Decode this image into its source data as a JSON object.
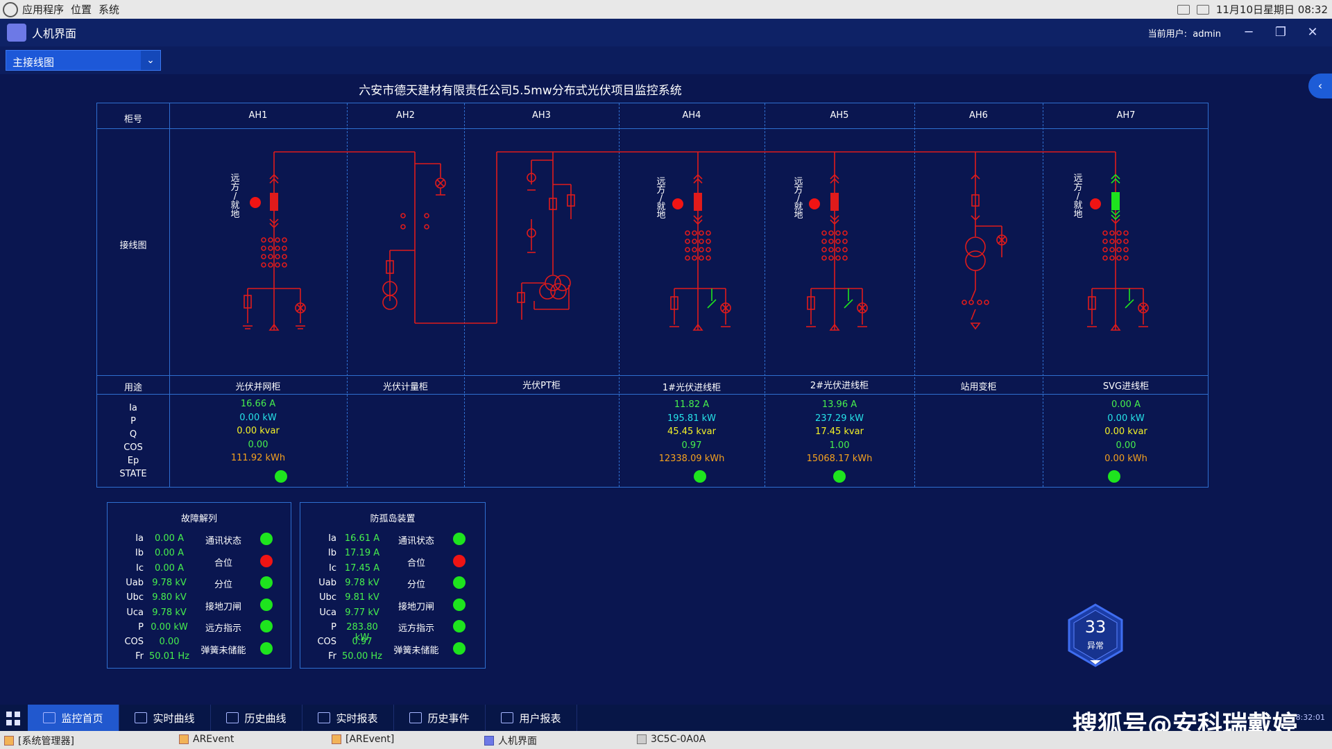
{
  "os_topbar": {
    "menu": [
      "应用程序",
      "位置",
      "系统"
    ],
    "datetime": "11月10日星期日 08:32"
  },
  "window": {
    "title": "人机界面",
    "user_label": "当前用户:",
    "user_name": "admin"
  },
  "view_select": {
    "value": "主接线图"
  },
  "page_title": "六安市德天建材有限责任公司5.5mw分布式光伏项目监控系统",
  "table": {
    "header_label": "柜号",
    "diagram_label": "接线图",
    "usage_label": "用途",
    "cabinets": [
      {
        "id": "AH1",
        "usage": "光伏并网柜",
        "ia": "16.66 A",
        "p": "0.00 kW",
        "q": "0.00 kvar",
        "cos": "0.00",
        "ep": "111.92 kWh",
        "state": true
      },
      {
        "id": "AH2",
        "usage": "光伏计量柜"
      },
      {
        "id": "AH3",
        "usage": "光伏PT柜"
      },
      {
        "id": "AH4",
        "usage": "1#光伏进线柜",
        "ia": "11.82 A",
        "p": "195.81 kW",
        "q": "45.45 kvar",
        "cos": "0.97",
        "ep": "12338.09 kWh",
        "state": true
      },
      {
        "id": "AH5",
        "usage": "2#光伏进线柜",
        "ia": "13.96 A",
        "p": "237.29 kW",
        "q": "17.45 kvar",
        "cos": "1.00",
        "ep": "15068.17 kWh",
        "state": true
      },
      {
        "id": "AH6",
        "usage": "站用变柜"
      },
      {
        "id": "AH7",
        "usage": "SVG进线柜",
        "ia": "0.00 A",
        "p": "0.00 kW",
        "q": "0.00 kvar",
        "cos": "0.00",
        "ep": "0.00 kWh",
        "state": true
      }
    ],
    "meas_labels": [
      "Ia",
      "P",
      "Q",
      "COS",
      "Ep"
    ],
    "state_label": "STATE",
    "remote_text": [
      "远",
      "方",
      "/",
      "就",
      "地"
    ]
  },
  "fault_panel": {
    "title": "故障解列",
    "rows": [
      [
        "Ia",
        "0.00 A"
      ],
      [
        "Ib",
        "0.00 A"
      ],
      [
        "Ic",
        "0.00 A"
      ],
      [
        "Uab",
        "9.78 kV"
      ],
      [
        "Ubc",
        "9.80 kV"
      ],
      [
        "Uca",
        "9.78 kV"
      ],
      [
        "P",
        "0.00 kW"
      ],
      [
        "COS",
        "0.00"
      ],
      [
        "Fr",
        "50.01 Hz"
      ]
    ],
    "status": [
      [
        "通讯状态",
        "green"
      ],
      [
        "合位",
        "red"
      ],
      [
        "分位",
        "green"
      ],
      [
        "接地刀闸",
        "green"
      ],
      [
        "远方指示",
        "green"
      ],
      [
        "弹簧未储能",
        "green"
      ]
    ]
  },
  "island_panel": {
    "title": "防孤岛装置",
    "rows": [
      [
        "Ia",
        "16.61 A"
      ],
      [
        "Ib",
        "17.19 A"
      ],
      [
        "Ic",
        "17.45 A"
      ],
      [
        "Uab",
        "9.78 kV"
      ],
      [
        "Ubc",
        "9.81 kV"
      ],
      [
        "Uca",
        "9.77 kV"
      ],
      [
        "P",
        "283.80 kW"
      ],
      [
        "COS",
        "0.97"
      ],
      [
        "Fr",
        "50.00 Hz"
      ]
    ],
    "status": [
      [
        "通讯状态",
        "green"
      ],
      [
        "合位",
        "red"
      ],
      [
        "分位",
        "green"
      ],
      [
        "接地刀闸",
        "green"
      ],
      [
        "远方指示",
        "green"
      ],
      [
        "弹簧未储能",
        "green"
      ]
    ]
  },
  "alarm_badge": {
    "count": "33",
    "label": "异常"
  },
  "bottom_tabs": [
    "监控首页",
    "实时曲线",
    "历史曲线",
    "实时报表",
    "历史事件",
    "用户报表"
  ],
  "watermark": "搜狐号@安科瑞戴婷",
  "clock": "8:32:01",
  "taskbar": [
    "[系统管理器]",
    "AREvent",
    "[AREvent]",
    "人机界面",
    "3C5C-0A0A"
  ]
}
